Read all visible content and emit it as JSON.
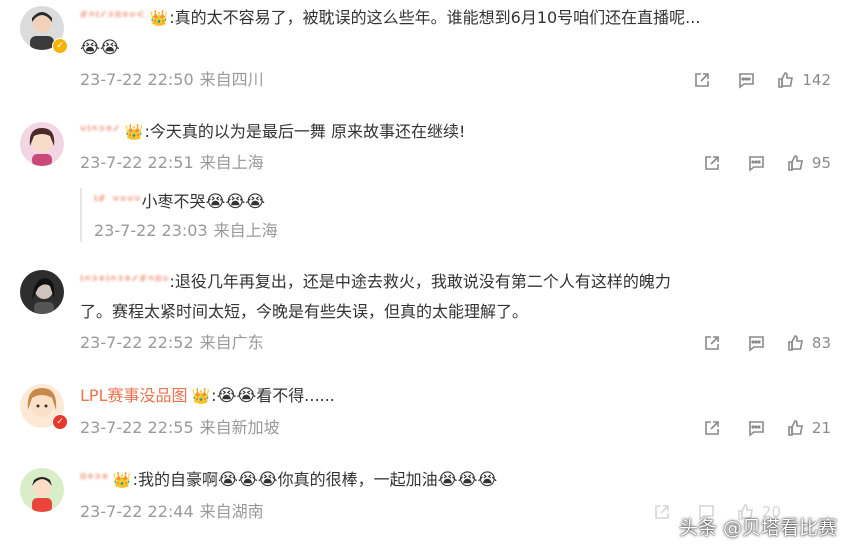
{
  "comments": [
    {
      "user": "ᐥᐢᑊᐟᐣᐦᐤᐡᑉ",
      "text": ":真的太不容易了，被耽误的这么些年。谁能想到6月10号咱们还在直播呢...",
      "emoji_line": "😭😭",
      "time": "23-7-22 22:50",
      "location": "来自四川",
      "likes": "142"
    },
    {
      "user": "ᐡᑊᐢᐣᐤᐟ",
      "text": ":今天真的以为是最后一舞 原来故事还在继续!",
      "time": "23-7-22 22:51",
      "location": "来自上海",
      "likes": "95",
      "reply": {
        "user": "ᑊᐥ ᐡᐡᐡᐡ",
        "text": "小枣不哭",
        "emoji": "😭😭😭",
        "time": "23-7-22 23:03",
        "location": "来自上海"
      }
    },
    {
      "user": "ᑊᐢᐣᐤᑊᐢᐣᐤᐟᐥᐢᐦᐡ",
      "text": ":退役几年再复出，还是中途去救火，我敢说没有第二个人有这样的魄力",
      "text2": "了。赛程太紧时间太短，今晚是有些失误，但真的太能理解了。",
      "time": "23-7-22 22:52",
      "location": "来自广东",
      "likes": "83"
    },
    {
      "user": "LPL赛事没品图",
      "text_pre": ":",
      "emoji": "😭😭",
      "text": "看不得......",
      "time": "23-7-22 22:55",
      "location": "来自新加坡",
      "likes": "21"
    },
    {
      "user": "ᐦᐤᐣᐤ",
      "text": ":我的自豪啊",
      "emoji": "😭😭😭",
      "text2": "你真的很棒，一起加油",
      "emoji2": "😭😭😭",
      "time": "23-7-22 22:44",
      "location": "来自湖南",
      "likes": "20"
    }
  ],
  "watermark": "头条 @贝塔看比赛",
  "colors": {
    "username": "#eb7350",
    "meta": "#999999",
    "verified_gold": "#f6b400",
    "verified_red": "#e8372b"
  },
  "icons": [
    "share-icon",
    "comment-icon",
    "like-icon",
    "crown-icon",
    "verified-icon"
  ]
}
